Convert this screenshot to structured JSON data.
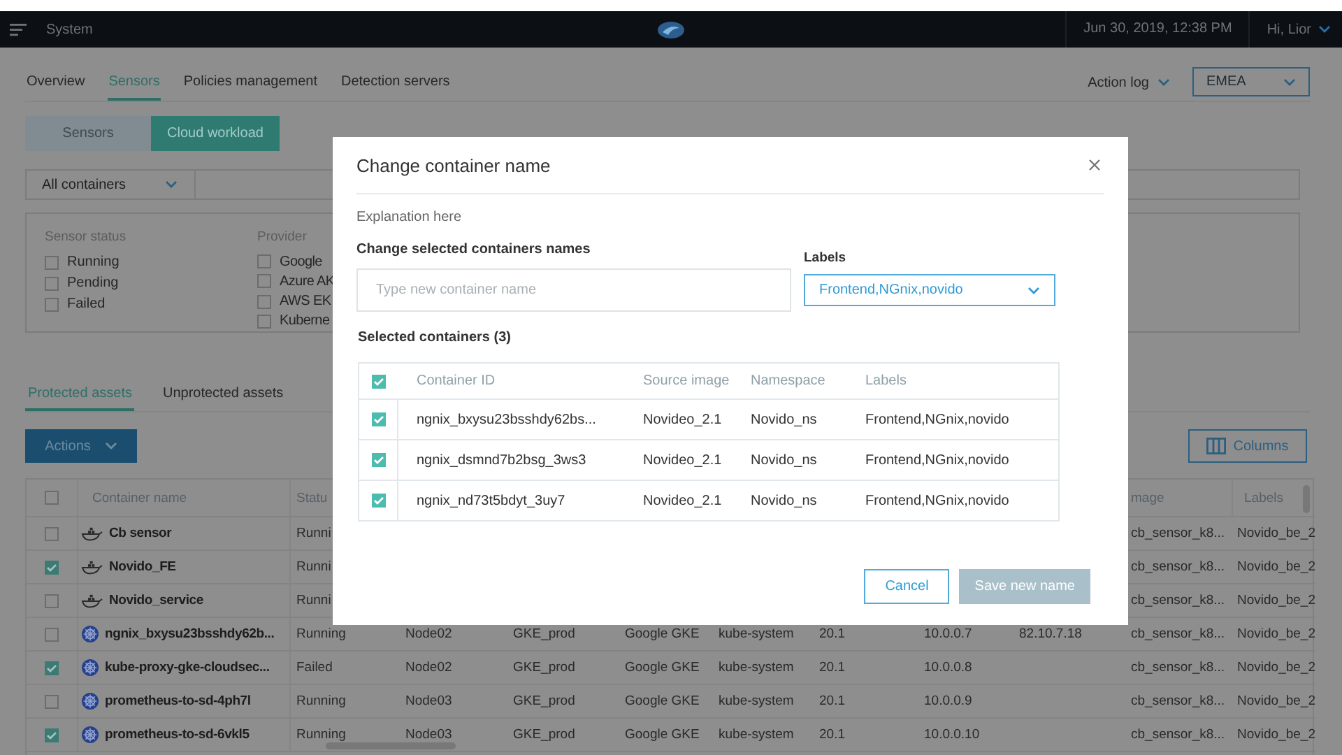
{
  "topbar": {
    "title": "System",
    "datetime": "Jun 30, 2019, 12:38 PM",
    "user": "Hi, Lior"
  },
  "nav": {
    "tabs": [
      {
        "label": "Overview",
        "selected": false
      },
      {
        "label": "Sensors",
        "selected": true
      },
      {
        "label": "Policies management",
        "selected": false
      },
      {
        "label": "Detection servers",
        "selected": false
      }
    ],
    "action_log": "Action log",
    "region": "EMEA"
  },
  "view_toggle": [
    {
      "label": "Sensors",
      "selected": false
    },
    {
      "label": "Cloud workload",
      "selected": true
    }
  ],
  "filter": {
    "scope": "All containers",
    "groups": [
      {
        "title": "Sensor status",
        "options": [
          {
            "label": "Running",
            "checked": false
          },
          {
            "label": "Pending",
            "checked": false
          },
          {
            "label": "Failed",
            "checked": false
          }
        ]
      },
      {
        "title": "Provider",
        "options": [
          {
            "label": "Google",
            "checked": false
          },
          {
            "label": "Azure AK",
            "checked": false
          },
          {
            "label": "AWS EK",
            "checked": false
          },
          {
            "label": "Kuberne",
            "checked": false
          }
        ]
      }
    ]
  },
  "asset_tabs": [
    {
      "label": "Protected assets",
      "selected": true
    },
    {
      "label": "Unprotected assets",
      "selected": false
    }
  ],
  "actions_button": "Actions",
  "columns_button": "Columns",
  "table": {
    "all_checked": false,
    "headers": {
      "name": "Container name",
      "status": "Statu",
      "image": "mage",
      "labels": "Labels"
    },
    "rows": [
      {
        "kind": "docker",
        "checked": false,
        "name": "Cb sensor",
        "status": "Runni",
        "image": "cb_sensor_k8...",
        "labels": "Novido_be_2"
      },
      {
        "kind": "docker",
        "checked": true,
        "name": "Novido_FE",
        "status": "Runni",
        "image": "cb_sensor_k8...",
        "labels": "Novido_be_2"
      },
      {
        "kind": "docker",
        "checked": false,
        "name": "Novido_service",
        "status": "Runni",
        "image": "cb_sensor_k8...",
        "labels": "Novido_be_2"
      },
      {
        "kind": "kubernetes",
        "checked": false,
        "name": "ngnix_bxysu23bsshdy62b...",
        "status": "Running",
        "node": "Node02",
        "cluster": "GKE_prod",
        "provider": "Google GKE",
        "namespace": "kube-system",
        "version": "20.1",
        "ip": "10.0.0.7",
        "external_ip": "82.10.7.18",
        "image": "cb_sensor_k8...",
        "labels": "Novido_be_2"
      },
      {
        "kind": "kubernetes",
        "checked": true,
        "name": "kube-proxy-gke-cloudsec...",
        "status": "Failed",
        "node": "Node02",
        "cluster": "GKE_prod",
        "provider": "Google GKE",
        "namespace": "kube-system",
        "version": "20.1",
        "ip": "10.0.0.8",
        "image": "cb_sensor_k8...",
        "labels": "Novido_be_2"
      },
      {
        "kind": "kubernetes",
        "checked": false,
        "name": "prometheus-to-sd-4ph7l",
        "status": "Running",
        "node": "Node03",
        "cluster": "GKE_prod",
        "provider": "Google GKE",
        "namespace": "kube-system",
        "version": "20.1",
        "ip": "10.0.0.9",
        "image": "cb_sensor_k8...",
        "labels": "Novido_be_2"
      },
      {
        "kind": "kubernetes",
        "checked": true,
        "name": "prometheus-to-sd-6vkl5",
        "status": "Running",
        "node": "Node03",
        "cluster": "GKE_prod",
        "provider": "Google GKE",
        "namespace": "kube-system",
        "version": "20.1",
        "ip": "10.0.0.10",
        "image": "cb_sensor_k8...",
        "labels": "Novido_be_2"
      }
    ]
  },
  "modal": {
    "title": "Change container name",
    "explanation": "Explanation here",
    "name_field": {
      "label": "Change selected containers names",
      "placeholder": "Type new container name"
    },
    "labels_field": {
      "label": "Labels",
      "value": "Frontend,NGnix,novido"
    },
    "selected_heading": "Selected containers (3)",
    "table": {
      "all_checked": true,
      "columns": [
        "Container ID",
        "Source image",
        "Namespace",
        "Labels"
      ],
      "rows": [
        {
          "checked": true,
          "container_id": "ngnix_bxysu23bsshdy62bs...",
          "source_image": "Novideo_2.1",
          "namespace": "Novido_ns",
          "labels": "Frontend,NGnix,novido"
        },
        {
          "checked": true,
          "container_id": "ngnix_dsmnd7b2bsg_3ws3",
          "source_image": "Novideo_2.1",
          "namespace": "Novido_ns",
          "labels": "Frontend,NGnix,novido"
        },
        {
          "checked": true,
          "container_id": "ngnix_nd73t5bdyt_3uy7",
          "source_image": "Novideo_2.1",
          "namespace": "Novido_ns",
          "labels": "Frontend,NGnix,novido"
        }
      ]
    },
    "buttons": [
      {
        "label": "Cancel",
        "disabled": false
      },
      {
        "label": "Save new name",
        "disabled": true
      }
    ]
  }
}
